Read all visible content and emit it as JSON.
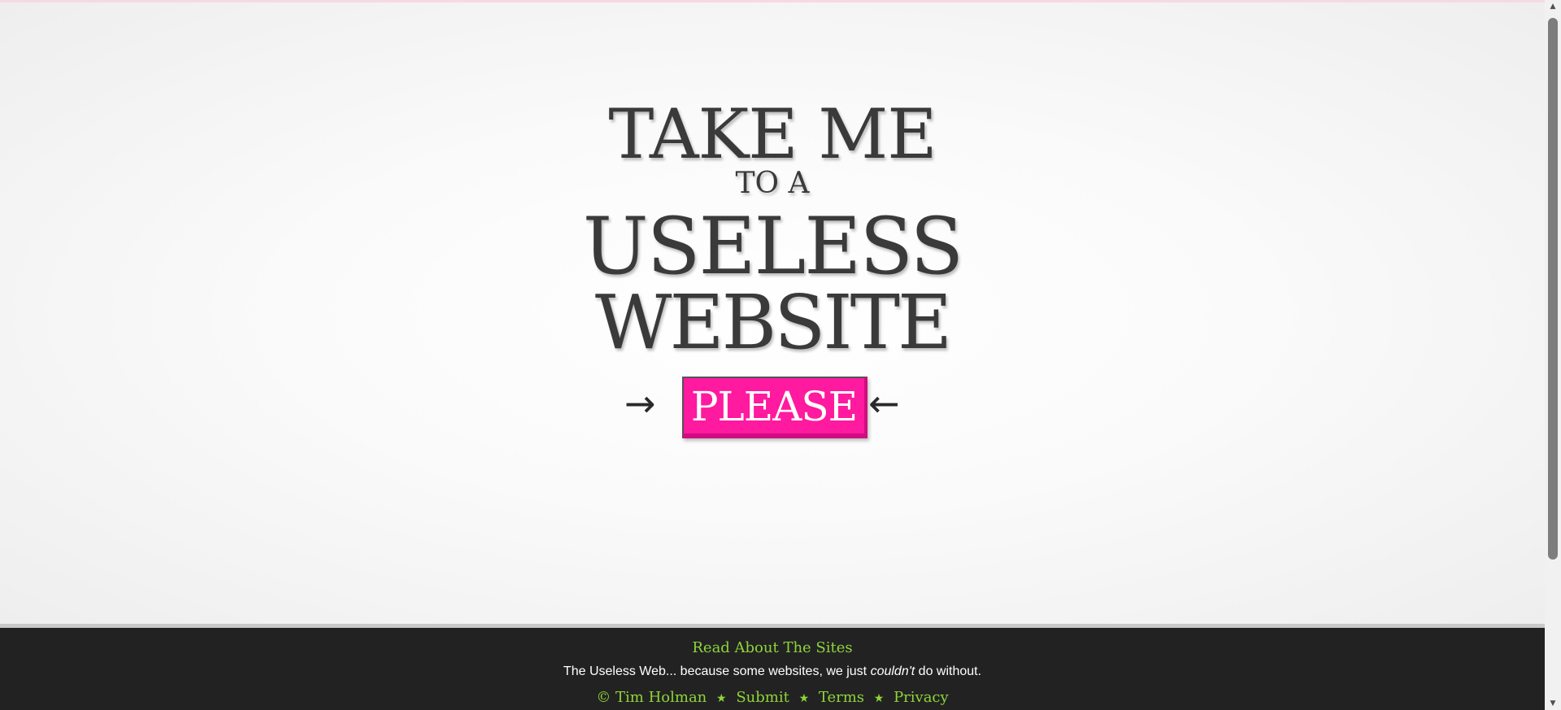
{
  "headline": {
    "line1": "TAKE ME",
    "line2": "TO A",
    "line3": "USELESS",
    "line4": "WEBSITE"
  },
  "button": {
    "label": "PLEASE",
    "arrow_left": "→",
    "arrow_right": "←",
    "color": "#ff1a9f"
  },
  "footer": {
    "read_about": "Read About The Sites",
    "tagline_before": "The Useless Web... because some websites, we just ",
    "tagline_em": "couldn't",
    "tagline_after": " do without.",
    "copyright": "© Tim Holman",
    "submit": "Submit",
    "terms": "Terms",
    "privacy": "Privacy",
    "separator": "★",
    "link_color": "#8fd43a"
  },
  "scrollbar": {
    "up_arrow": "▲",
    "down_arrow": "▼"
  }
}
